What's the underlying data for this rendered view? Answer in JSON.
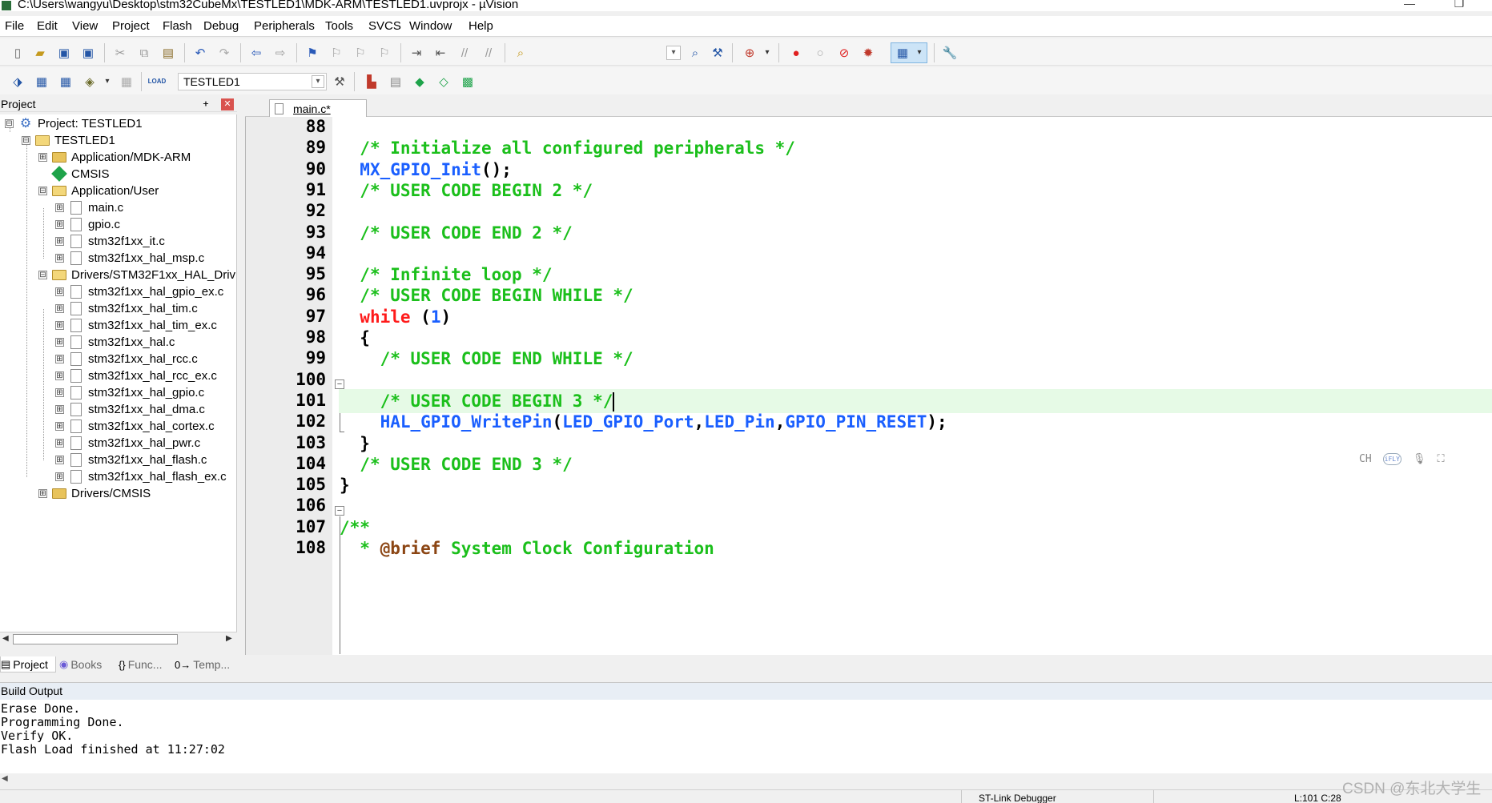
{
  "window": {
    "title": "C:\\Users\\wangyu\\Desktop\\stm32CubeMx\\TESTLED1\\MDK-ARM\\TESTLED1.uvprojx - µVision",
    "minimize": "—",
    "maximize": "❐"
  },
  "menu": [
    "File",
    "Edit",
    "View",
    "Project",
    "Flash",
    "Debug",
    "Peripherals",
    "Tools",
    "SVCS",
    "Window",
    "Help"
  ],
  "toolbar": {
    "target": "TESTLED1",
    "load_label": "LOAD"
  },
  "project_panel": {
    "title": "Project",
    "pin": "ᚐ",
    "close": "✕",
    "tree": [
      {
        "label": "Project: TESTLED1",
        "expander": "⊟",
        "icon": "project-icon"
      },
      {
        "label": "TESTLED1",
        "expander": "⊟",
        "icon": "target-folder-icon"
      },
      {
        "label": "Application/MDK-ARM",
        "expander": "⊞",
        "icon": "folder-icon"
      },
      {
        "label": "CMSIS",
        "expander": "",
        "icon": "cmsis-icon"
      },
      {
        "label": "Application/User",
        "expander": "⊟",
        "icon": "folder-open-icon"
      },
      {
        "label": "main.c",
        "expander": "⊞",
        "icon": "file-icon"
      },
      {
        "label": "gpio.c",
        "expander": "⊞",
        "icon": "file-icon"
      },
      {
        "label": "stm32f1xx_it.c",
        "expander": "⊞",
        "icon": "file-icon"
      },
      {
        "label": "stm32f1xx_hal_msp.c",
        "expander": "⊞",
        "icon": "file-icon"
      },
      {
        "label": "Drivers/STM32F1xx_HAL_Driv",
        "expander": "⊟",
        "icon": "folder-open-icon"
      },
      {
        "label": "stm32f1xx_hal_gpio_ex.c",
        "expander": "⊞",
        "icon": "file-icon"
      },
      {
        "label": "stm32f1xx_hal_tim.c",
        "expander": "⊞",
        "icon": "file-icon"
      },
      {
        "label": "stm32f1xx_hal_tim_ex.c",
        "expander": "⊞",
        "icon": "file-icon"
      },
      {
        "label": "stm32f1xx_hal.c",
        "expander": "⊞",
        "icon": "file-icon"
      },
      {
        "label": "stm32f1xx_hal_rcc.c",
        "expander": "⊞",
        "icon": "file-icon"
      },
      {
        "label": "stm32f1xx_hal_rcc_ex.c",
        "expander": "⊞",
        "icon": "file-icon"
      },
      {
        "label": "stm32f1xx_hal_gpio.c",
        "expander": "⊞",
        "icon": "file-icon"
      },
      {
        "label": "stm32f1xx_hal_dma.c",
        "expander": "⊞",
        "icon": "file-icon"
      },
      {
        "label": "stm32f1xx_hal_cortex.c",
        "expander": "⊞",
        "icon": "file-icon"
      },
      {
        "label": "stm32f1xx_hal_pwr.c",
        "expander": "⊞",
        "icon": "file-icon"
      },
      {
        "label": "stm32f1xx_hal_flash.c",
        "expander": "⊞",
        "icon": "file-icon"
      },
      {
        "label": "stm32f1xx_hal_flash_ex.c",
        "expander": "⊞",
        "icon": "file-icon"
      },
      {
        "label": "Drivers/CMSIS",
        "expander": "⊞",
        "icon": "folder-icon"
      }
    ],
    "tabs": [
      {
        "label": "Project",
        "icon": "▤"
      },
      {
        "label": "Books",
        "icon": "◉"
      },
      {
        "label": "Func...",
        "icon": "{}"
      },
      {
        "label": "Temp...",
        "icon": "0→"
      }
    ]
  },
  "editor": {
    "tab": "main.c*",
    "current_line": 101,
    "lines": [
      {
        "n": "88",
        "segs": []
      },
      {
        "n": "89",
        "segs": [
          {
            "t": "  ",
            "c": "pl"
          },
          {
            "t": "/* Initialize all configured peripherals */",
            "c": "com"
          }
        ]
      },
      {
        "n": "90",
        "segs": [
          {
            "t": "  ",
            "c": "pl"
          },
          {
            "t": "MX_GPIO_Init",
            "c": "fn"
          },
          {
            "t": "();",
            "c": "pl"
          }
        ]
      },
      {
        "n": "91",
        "segs": [
          {
            "t": "  ",
            "c": "pl"
          },
          {
            "t": "/* USER CODE BEGIN 2 */",
            "c": "com"
          }
        ]
      },
      {
        "n": "92",
        "segs": []
      },
      {
        "n": "93",
        "segs": [
          {
            "t": "  ",
            "c": "pl"
          },
          {
            "t": "/* USER CODE END 2 */",
            "c": "com"
          }
        ]
      },
      {
        "n": "94",
        "segs": []
      },
      {
        "n": "95",
        "segs": [
          {
            "t": "  ",
            "c": "pl"
          },
          {
            "t": "/* Infinite loop */",
            "c": "com"
          }
        ]
      },
      {
        "n": "96",
        "segs": [
          {
            "t": "  ",
            "c": "pl"
          },
          {
            "t": "/* USER CODE BEGIN WHILE */",
            "c": "com"
          }
        ]
      },
      {
        "n": "97",
        "segs": [
          {
            "t": "  ",
            "c": "pl"
          },
          {
            "t": "while",
            "c": "kw"
          },
          {
            "t": " (",
            "c": "pl"
          },
          {
            "t": "1",
            "c": "num"
          },
          {
            "t": ")",
            "c": "pl"
          }
        ]
      },
      {
        "n": "98",
        "segs": [
          {
            "t": "  {",
            "c": "pl"
          }
        ]
      },
      {
        "n": "99",
        "segs": [
          {
            "t": "    ",
            "c": "pl"
          },
          {
            "t": "/* USER CODE END WHILE */",
            "c": "com"
          }
        ]
      },
      {
        "n": "100",
        "segs": []
      },
      {
        "n": "101",
        "segs": [
          {
            "t": "    ",
            "c": "pl"
          },
          {
            "t": "/* USER CODE BEGIN 3 */",
            "c": "com"
          }
        ]
      },
      {
        "n": "102",
        "segs": [
          {
            "t": "    ",
            "c": "pl"
          },
          {
            "t": "HAL_GPIO_WritePin",
            "c": "fn"
          },
          {
            "t": "(",
            "c": "pl"
          },
          {
            "t": "LED_GPIO_Port",
            "c": "fn"
          },
          {
            "t": ",",
            "c": "pl"
          },
          {
            "t": "LED_Pin",
            "c": "fn"
          },
          {
            "t": ",",
            "c": "pl"
          },
          {
            "t": "GPIO_PIN_RESET",
            "c": "fn"
          },
          {
            "t": ");",
            "c": "pl"
          }
        ]
      },
      {
        "n": "103",
        "segs": [
          {
            "t": "  }",
            "c": "pl"
          }
        ]
      },
      {
        "n": "104",
        "segs": [
          {
            "t": "  ",
            "c": "pl"
          },
          {
            "t": "/* USER CODE END 3 */",
            "c": "com"
          }
        ]
      },
      {
        "n": "105",
        "segs": [
          {
            "t": "}",
            "c": "pl"
          }
        ]
      },
      {
        "n": "106",
        "segs": []
      },
      {
        "n": "107",
        "segs": [
          {
            "t": "/**",
            "c": "com"
          }
        ]
      },
      {
        "n": "108",
        "segs": [
          {
            "t": "  * ",
            "c": "com"
          },
          {
            "t": "@brief",
            "c": "doc"
          },
          {
            "t": " System Clock Configuration",
            "c": "com"
          }
        ]
      }
    ],
    "ime": {
      "lang": "CH",
      "logo": "iFLY"
    }
  },
  "build_output": {
    "title": "Build Output",
    "lines": [
      "Erase Done.",
      "Programming Done.",
      "Verify OK.",
      "Flash Load finished at 11:27:02"
    ]
  },
  "status": {
    "debugger": "ST-Link Debugger",
    "position": "L:101 C:28"
  },
  "watermark": "CSDN @东北大学生",
  "colors": {
    "comment": "#1bbf1b",
    "identifier": "#1a5fff",
    "keyword": "#ff1a1a",
    "current_line": "#e6fae6"
  }
}
